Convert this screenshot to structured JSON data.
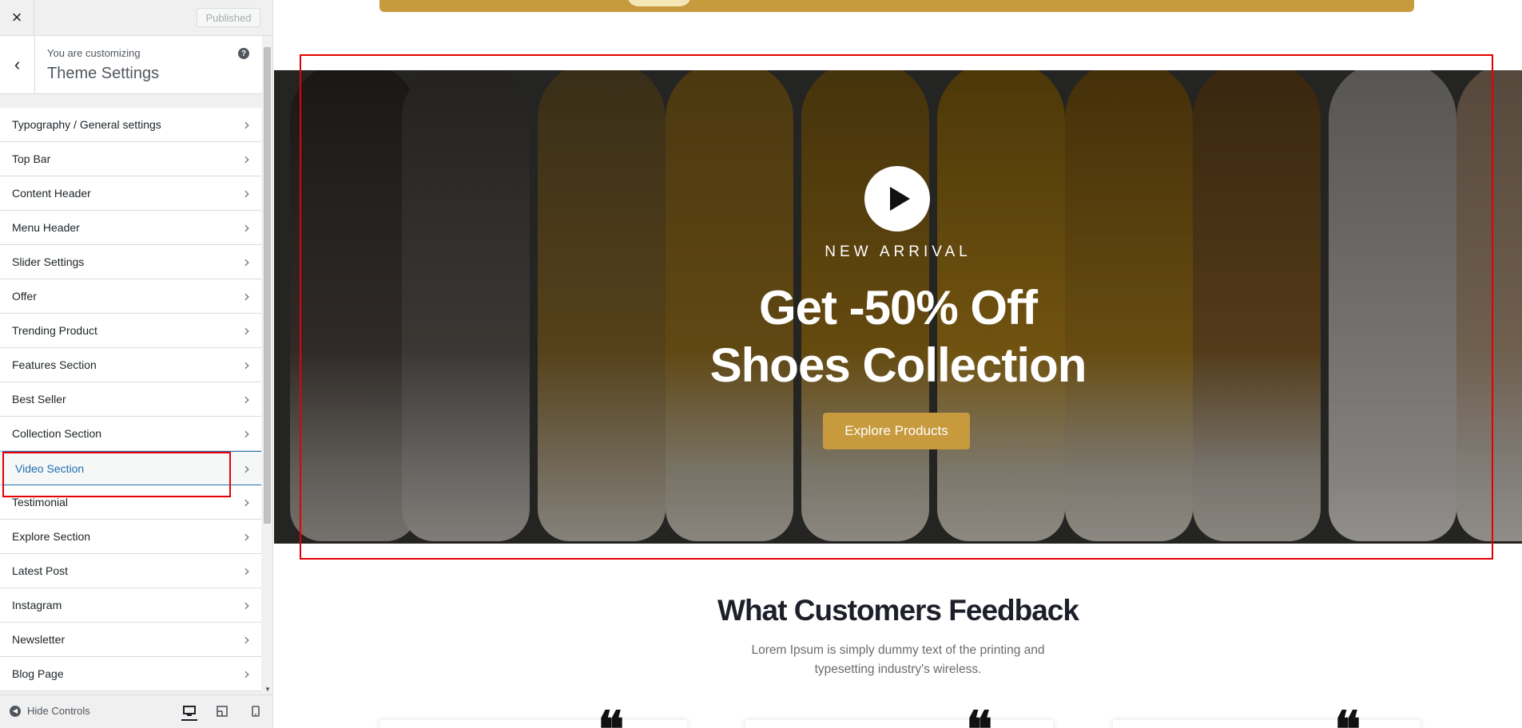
{
  "customizer": {
    "close_icon": "×",
    "publish_label": "Published",
    "back_icon": "‹",
    "customizing_label": "You are customizing",
    "panel_title": "Theme Settings",
    "help_icon": "?",
    "sections": [
      {
        "label": "Typography / General settings"
      },
      {
        "label": "Top Bar"
      },
      {
        "label": "Content Header"
      },
      {
        "label": "Menu Header"
      },
      {
        "label": "Slider Settings"
      },
      {
        "label": "Offer"
      },
      {
        "label": "Trending Product"
      },
      {
        "label": "Features Section"
      },
      {
        "label": "Best Seller"
      },
      {
        "label": "Collection Section"
      },
      {
        "label": "Video Section"
      },
      {
        "label": "Testimonial"
      },
      {
        "label": "Explore Section"
      },
      {
        "label": "Latest Post"
      },
      {
        "label": "Instagram"
      },
      {
        "label": "Newsletter"
      },
      {
        "label": "Blog Page"
      }
    ],
    "active_section": "Video Section",
    "chevron_icon": "›",
    "footer": {
      "hide_controls_label": "Hide Controls",
      "devices": [
        "desktop-icon",
        "tablet-icon",
        "mobile-icon"
      ]
    }
  },
  "preview": {
    "video_section": {
      "subtitle": "NEW ARRIVAL",
      "title_line1": "Get -50% Off",
      "title_line2": "Shoes Collection",
      "button_label": "Explore Products",
      "play_icon": "play-icon"
    },
    "testimonials": {
      "title": "What Customers Feedback",
      "description": "Lorem Ipsum is simply dummy text of the printing and typesetting industry's wireless.",
      "quote_mark": "❝"
    }
  },
  "colors": {
    "accent": "#c69a3d",
    "active_link": "#2271b1",
    "annotation": "#e60000"
  }
}
